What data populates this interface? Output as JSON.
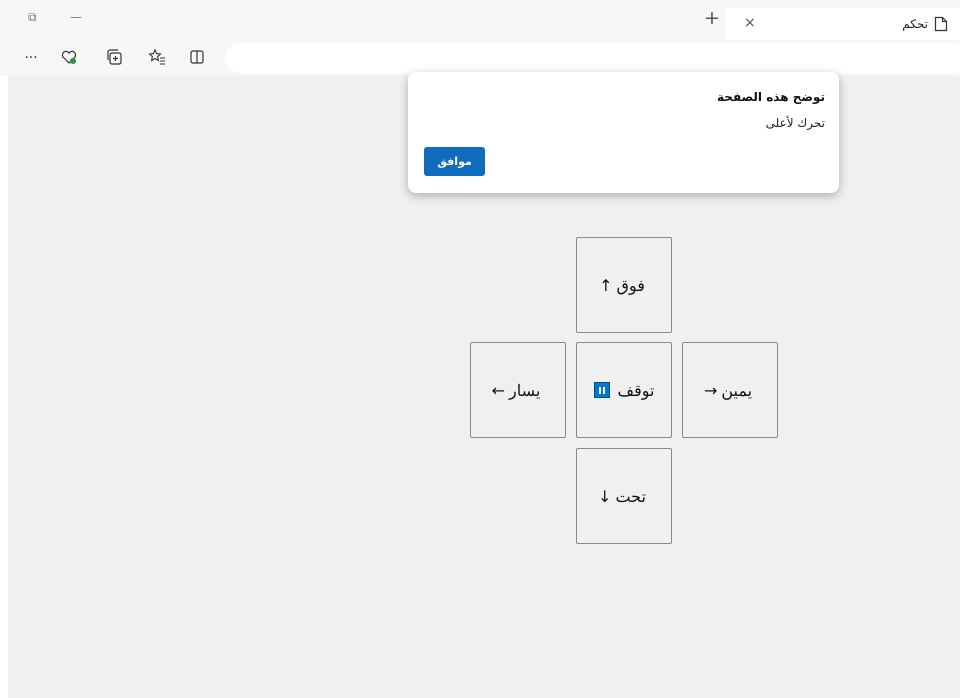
{
  "browser": {
    "tab_title": "تحكم",
    "tab_close": "×",
    "new_tab": "+",
    "minimize": "—",
    "restore": "⧉",
    "toolbar_more": "···"
  },
  "dialog": {
    "title": "توضح هذه الصفحة",
    "message": "تحرك لأعلى",
    "ok_label": "موافق"
  },
  "controls": {
    "up": {
      "label": "فوق",
      "arrow": "↑"
    },
    "left": {
      "label": "يسار",
      "arrow": "←"
    },
    "stop": {
      "label": "توقف"
    },
    "right": {
      "label": "يمين",
      "arrow": "→"
    },
    "down": {
      "label": "تحت",
      "arrow": "↓"
    }
  },
  "colors": {
    "accent": "#0f6cbd",
    "page_bg": "#f0f0f0"
  }
}
